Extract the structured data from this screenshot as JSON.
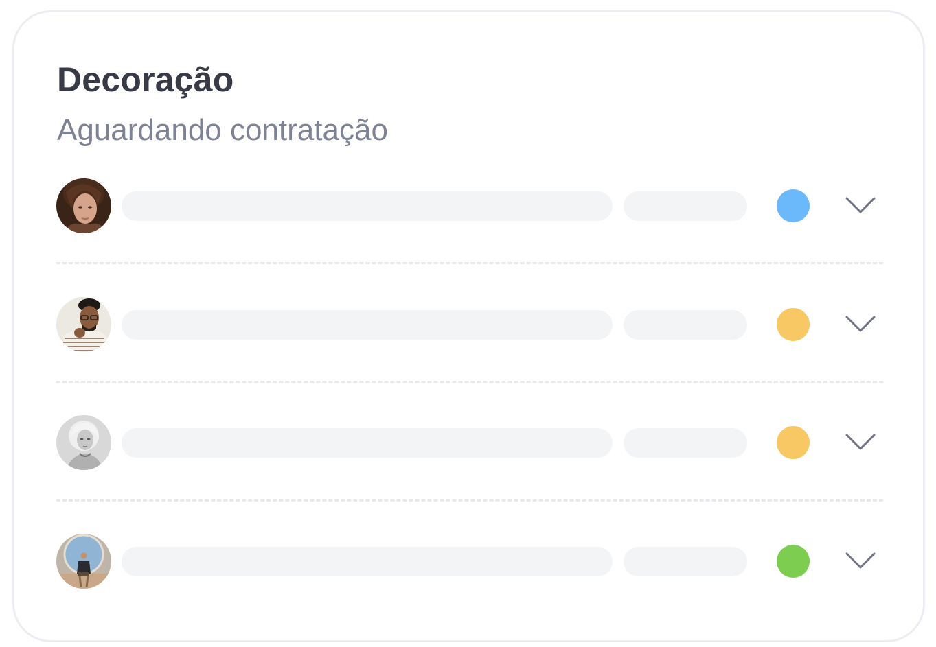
{
  "card": {
    "title": "Decoração",
    "subtitle": "Aguardando contratação"
  },
  "rows": [
    {
      "avatar": "avatar-woman-brown-hair",
      "status_color": "#6bb8fb",
      "status": "blue",
      "icon": "chevron-down-icon"
    },
    {
      "avatar": "avatar-man-glasses",
      "status_color": "#f8c864",
      "status": "yellow",
      "icon": "chevron-down-icon"
    },
    {
      "avatar": "avatar-woman-blonde-bw",
      "status_color": "#f8c864",
      "status": "yellow",
      "icon": "chevron-down-icon"
    },
    {
      "avatar": "avatar-person-sitting",
      "status_color": "#7ccd50",
      "status": "green",
      "icon": "chevron-down-icon"
    }
  ],
  "colors": {
    "title": "#383b46",
    "subtitle": "#7d8294",
    "placeholder": "#f3f4f6",
    "chevron": "#6f7385",
    "border": "#ebedf2"
  }
}
